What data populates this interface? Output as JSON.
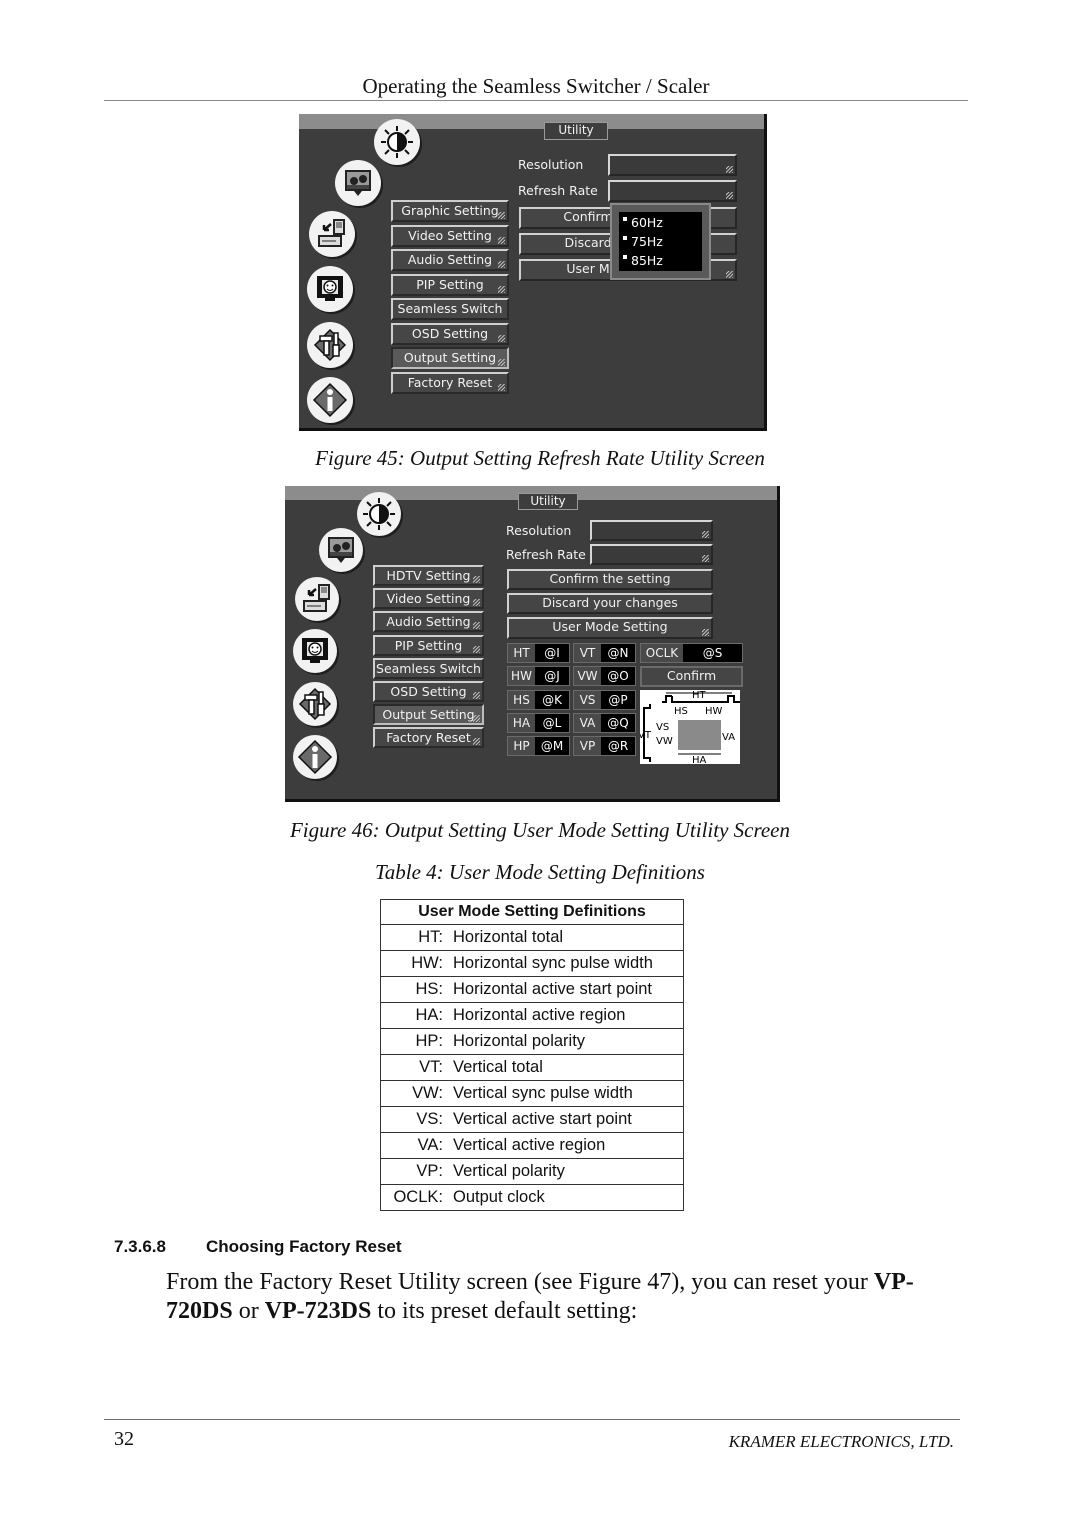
{
  "header": {
    "title": "Operating the Seamless Switcher / Scaler"
  },
  "figure45": {
    "caption": "Figure 45: Output Setting Refresh Rate Utility Screen",
    "tab_label": "Utility",
    "menu_items": [
      {
        "label": "Graphic Setting",
        "active": false
      },
      {
        "label": "Video Setting",
        "active": false
      },
      {
        "label": "Audio Setting",
        "active": false
      },
      {
        "label": "PIP Setting",
        "active": false
      },
      {
        "label": "Seamless Switch",
        "active": false
      },
      {
        "label": "OSD Setting",
        "active": false
      },
      {
        "label": "Output Setting",
        "active": true
      },
      {
        "label": "Factory Reset",
        "active": false
      }
    ],
    "resolution_label": "Resolution",
    "refresh_rate_label": "Refresh Rate",
    "actions": [
      "Confirm",
      "Discard",
      "User M"
    ],
    "dropdown_options": [
      "60Hz",
      "75Hz",
      "85Hz"
    ]
  },
  "figure46": {
    "caption": "Figure 46: Output Setting User Mode Setting Utility Screen",
    "tab_label": "Utility",
    "menu_items": [
      {
        "label": "HDTV Setting",
        "active": false
      },
      {
        "label": "Video Setting",
        "active": false
      },
      {
        "label": "Audio Setting",
        "active": false
      },
      {
        "label": "PIP Setting",
        "active": false
      },
      {
        "label": "Seamless Switch",
        "active": false
      },
      {
        "label": "OSD Setting",
        "active": false
      },
      {
        "label": "Output Setting",
        "active": true
      },
      {
        "label": "Factory Reset",
        "active": false
      }
    ],
    "resolution_label": "Resolution",
    "refresh_rate_label": "Refresh Rate",
    "actions": [
      "Confirm the setting",
      "Discard your changes",
      "User Mode Setting"
    ],
    "params_left": [
      {
        "key": "HT",
        "value": "@I"
      },
      {
        "key": "HW",
        "value": "@J"
      },
      {
        "key": "HS",
        "value": "@K"
      },
      {
        "key": "HA",
        "value": "@L"
      },
      {
        "key": "HP",
        "value": "@M"
      }
    ],
    "params_mid": [
      {
        "key": "VT",
        "value": "@N"
      },
      {
        "key": "VW",
        "value": "@O"
      },
      {
        "key": "VS",
        "value": "@P"
      },
      {
        "key": "VA",
        "value": "@Q"
      },
      {
        "key": "VP",
        "value": "@R"
      }
    ],
    "oclk": {
      "key": "OCLK",
      "value": "@S"
    },
    "confirm_label": "Confirm",
    "diagram_labels": {
      "ht": "HT",
      "hs": "HS",
      "hw": "HW",
      "vt": "VT",
      "vs": "VS",
      "vw": "VW",
      "va": "VA",
      "ha": "HA"
    }
  },
  "table": {
    "caption": "Table 4: User Mode Setting Definitions",
    "header": "User Mode Setting Definitions",
    "rows": [
      {
        "abbr": "HT:",
        "definition": "Horizontal total"
      },
      {
        "abbr": "HW:",
        "definition": "Horizontal sync pulse width"
      },
      {
        "abbr": "HS:",
        "definition": "Horizontal active start point"
      },
      {
        "abbr": "HA:",
        "definition": "Horizontal active region"
      },
      {
        "abbr": "HP:",
        "definition": "Horizontal polarity"
      },
      {
        "abbr": "VT:",
        "definition": "Vertical total"
      },
      {
        "abbr": "VW:",
        "definition": "Vertical sync pulse width"
      },
      {
        "abbr": "VS:",
        "definition": "Vertical active start point"
      },
      {
        "abbr": "VA:",
        "definition": "Vertical active region"
      },
      {
        "abbr": "VP:",
        "definition": "Vertical polarity"
      },
      {
        "abbr": "OCLK:",
        "definition": "Output clock"
      }
    ]
  },
  "section": {
    "number": "7.3.6.8",
    "title": "Choosing Factory Reset",
    "body_part1": "From the Factory Reset Utility screen (see Figure 47), you can reset your ",
    "model1": "VP-720DS",
    "body_or": " or ",
    "model2": "VP-723DS",
    "body_part2": " to its preset default setting:"
  },
  "footer": {
    "page_number": "32",
    "company": "KRAMER ELECTRONICS, LTD."
  },
  "icons": [
    "brightness-icon",
    "picture-icon",
    "input-icon",
    "geometry-icon",
    "tools-icon",
    "info-icon"
  ]
}
